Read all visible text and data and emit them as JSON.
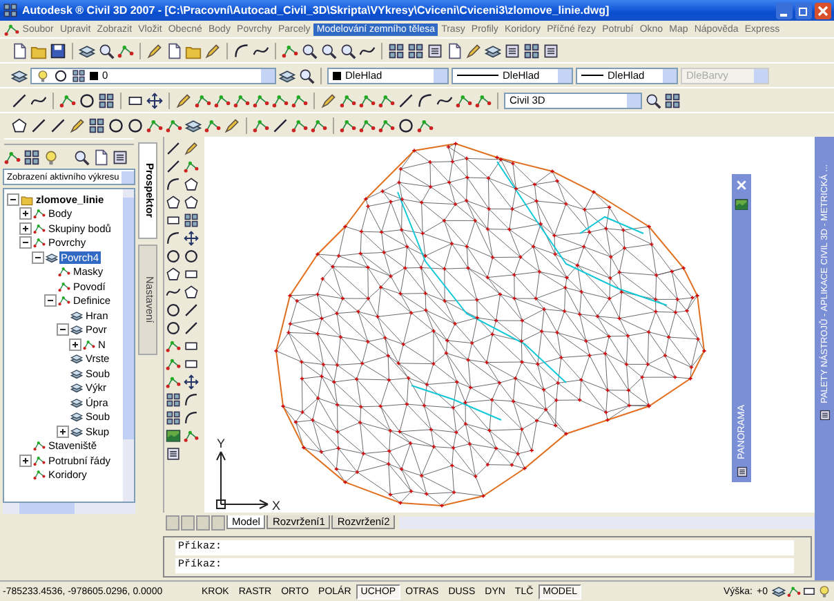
{
  "window": {
    "title": "Autodesk ® Civil 3D 2007 - [C:\\Pracovní\\Autocad_Civil_3D\\Skripta\\VYkresy\\Cviceni\\Cviceni3\\zlomove_linie.dwg]"
  },
  "menu": [
    {
      "label": "Soubor",
      "selected": false
    },
    {
      "label": "Upravit",
      "selected": false
    },
    {
      "label": "Zobrazit",
      "selected": false
    },
    {
      "label": "Vložit",
      "selected": false
    },
    {
      "label": "Obecné",
      "selected": false
    },
    {
      "label": "Body",
      "selected": false
    },
    {
      "label": "Povrchy",
      "selected": false
    },
    {
      "label": "Parcely",
      "selected": false
    },
    {
      "label": "Modelování zemního tělesa",
      "selected": true
    },
    {
      "label": "Trasy",
      "selected": false
    },
    {
      "label": "Profily",
      "selected": false
    },
    {
      "label": "Koridory",
      "selected": false
    },
    {
      "label": "Příčné řezy",
      "selected": false
    },
    {
      "label": "Potrubí",
      "selected": false
    },
    {
      "label": "Okno",
      "selected": false
    },
    {
      "label": "Map",
      "selected": false
    },
    {
      "label": "Nápověda",
      "selected": false
    },
    {
      "label": "Express",
      "selected": false
    }
  ],
  "layer_toolbar": {
    "layer": "0",
    "color_setting": "DleHlad",
    "linetype": "DleHlad",
    "lineweight": "DleHlad",
    "plot_style": {
      "value": "DleBarvy",
      "disabled": true
    }
  },
  "workspace": {
    "value": "Civil 3D"
  },
  "prospector": {
    "view_dropdown": "Zobrazení aktivního výkresu",
    "tree": [
      {
        "label": "zlomove_linie",
        "expanded": true,
        "selected": false,
        "children": [
          {
            "label": "Body",
            "expanded": false,
            "selected": false
          },
          {
            "label": "Skupiny bodů",
            "expanded": false,
            "selected": false
          },
          {
            "label": "Povrchy",
            "expanded": true,
            "selected": false,
            "children": [
              {
                "label": "Povrch4",
                "expanded": true,
                "selected": true,
                "children": [
                  {
                    "label": "Masky",
                    "selected": false
                  },
                  {
                    "label": "Povodí",
                    "selected": false
                  },
                  {
                    "label": "Definice",
                    "expanded": true,
                    "selected": false,
                    "children": [
                      {
                        "label": "Hran",
                        "selected": false
                      },
                      {
                        "label": "Povr",
                        "expanded": true,
                        "selected": false,
                        "children": [
                          {
                            "label": "N",
                            "expanded": false,
                            "selected": false
                          }
                        ]
                      },
                      {
                        "label": "Vrste",
                        "selected": false
                      },
                      {
                        "label": "Soub",
                        "selected": false
                      },
                      {
                        "label": "Výkr",
                        "selected": false
                      },
                      {
                        "label": "Úpra",
                        "selected": false
                      },
                      {
                        "label": "Soub",
                        "selected": false
                      },
                      {
                        "label": "Skup",
                        "expanded": false,
                        "selected": false
                      }
                    ]
                  }
                ]
              }
            ]
          },
          {
            "label": "Staveniště",
            "selected": false
          },
          {
            "label": "Potrubní řády",
            "expanded": false,
            "selected": false
          },
          {
            "label": "Koridory",
            "selected": false
          }
        ]
      }
    ]
  },
  "side_tabs": [
    {
      "label": "Prospektor",
      "selected": true
    },
    {
      "label": "Nastavení",
      "selected": false
    }
  ],
  "drawing": {
    "axis_labels": [
      "Y",
      "X"
    ]
  },
  "layout_tabs": [
    {
      "label": "Model",
      "selected": true
    },
    {
      "label": "Rozvržení1",
      "selected": false
    },
    {
      "label": "Rozvržení2",
      "selected": false
    }
  ],
  "palettes": [
    {
      "title": "PANORAMA"
    },
    {
      "title": "PALETY NÁSTROJŮ - APLIKACE CIVIL 3D - METRICKÁ ..."
    }
  ],
  "command_lines": [
    "Příkaz:",
    "Příkaz:"
  ],
  "status_bar": {
    "coordinates": "-785233.4536, -978605.0296, 0.0000",
    "toggles": [
      {
        "label": "KROK",
        "on": false
      },
      {
        "label": "RASTR",
        "on": false
      },
      {
        "label": "ORTO",
        "on": false
      },
      {
        "label": "POLÁR",
        "on": false
      },
      {
        "label": "UCHOP",
        "on": true
      },
      {
        "label": "OTRAS",
        "on": false
      },
      {
        "label": "DUSS",
        "on": false
      },
      {
        "label": "DYN",
        "on": false
      },
      {
        "label": "TLČ",
        "on": false
      },
      {
        "label": "MODEL",
        "on": true
      }
    ],
    "elevation_label": "Výška:",
    "elevation_value": "+0"
  }
}
